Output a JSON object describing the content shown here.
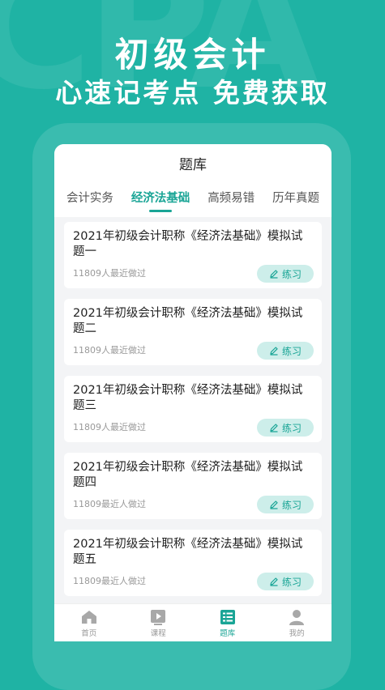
{
  "hero": {
    "watermark": "CPA",
    "title": "初级会计",
    "subtitle": "心速记考点 免费获取"
  },
  "app": {
    "title": "题库",
    "tabs": [
      {
        "label": "会计实务"
      },
      {
        "label": "经济法基础"
      },
      {
        "label": "高频易错"
      },
      {
        "label": "历年真题"
      }
    ],
    "items": [
      {
        "title": "2021年初级会计职称《经济法基础》模拟试题一",
        "meta": "11809人最近做过",
        "button": "练习"
      },
      {
        "title": "2021年初级会计职称《经济法基础》模拟试题二",
        "meta": "11809人最近做过",
        "button": "练习"
      },
      {
        "title": "2021年初级会计职称《经济法基础》模拟试题三",
        "meta": "11809人最近做过",
        "button": "练习"
      },
      {
        "title": "2021年初级会计职称《经济法基础》模拟试题四",
        "meta": "11809最近人做过",
        "button": "练习"
      },
      {
        "title": "2021年初级会计职称《经济法基础》模拟试题五",
        "meta": "11809最近人做过",
        "button": "练习"
      }
    ],
    "tabbar": [
      {
        "label": "首页",
        "icon": "home-icon"
      },
      {
        "label": "课程",
        "icon": "video-icon"
      },
      {
        "label": "题库",
        "icon": "list-icon"
      },
      {
        "label": "我的",
        "icon": "user-icon"
      }
    ]
  },
  "colors": {
    "brand": "#1fb3a4",
    "accent": "#1aa596",
    "button_bg": "#cdeeea"
  }
}
